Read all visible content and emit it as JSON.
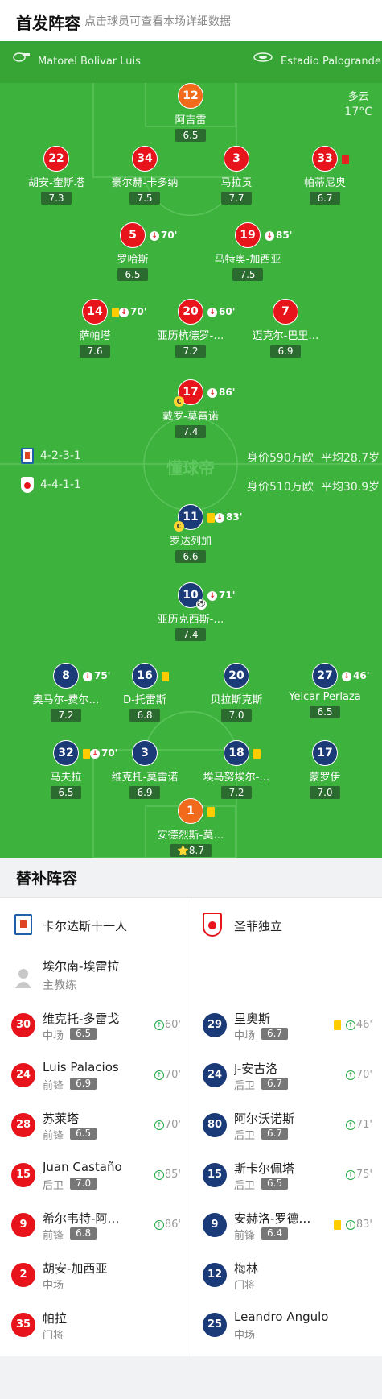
{
  "header": {
    "title": "首发阵容",
    "subtitle": "点击球员可查看本场详细数据"
  },
  "match_info": {
    "referee": "Matorel Bolivar Luis",
    "stadium": "Estadio Palogrande",
    "weather": "多云",
    "temperature": "17°C"
  },
  "colors": {
    "pitch": "#3db23d",
    "home_kit": "#e8141c",
    "away_kit": "#1a3a78",
    "goalkeeper_home": "#f26a1b",
    "goalkeeper_away": "#f26a1b",
    "yellow_card": "#ffcc00",
    "red_card": "#e52222"
  },
  "watermark": "懂球帝",
  "home_formation": {
    "formation": "4-2-3-1",
    "value": "身价590万欧",
    "avg_age": "平均28.7岁"
  },
  "away_formation": {
    "formation": "4-4-1-1",
    "value": "身价510万欧",
    "avg_age": "平均30.9岁"
  },
  "home_players": [
    {
      "number": "12",
      "name": "阿吉雷",
      "rating": "6.5",
      "gk": true,
      "events": []
    },
    {
      "number": "22",
      "name": "胡安-奎斯塔",
      "rating": "7.3",
      "events": []
    },
    {
      "number": "34",
      "name": "豪尔赫-卡多纳",
      "rating": "7.5",
      "events": []
    },
    {
      "number": "3",
      "name": "马拉贡",
      "rating": "7.7",
      "events": []
    },
    {
      "number": "33",
      "name": "帕蒂尼奥",
      "rating": "6.7",
      "events": [
        "red-card"
      ]
    },
    {
      "number": "5",
      "name": "罗哈斯",
      "rating": "6.5",
      "sub_minute": "70'"
    },
    {
      "number": "19",
      "name": "马特奥-加西亚",
      "rating": "7.5",
      "sub_minute": "85'"
    },
    {
      "number": "14",
      "name": "萨帕塔",
      "rating": "7.6",
      "sub_minute": "70'",
      "yellow": true
    },
    {
      "number": "20",
      "name": "亚历杭德罗-…",
      "rating": "7.2",
      "sub_minute": "60'"
    },
    {
      "number": "7",
      "name": "迈克尔-巴里…",
      "rating": "6.9"
    },
    {
      "number": "17",
      "name": "戴罗-莫雷诺",
      "rating": "7.4",
      "sub_minute": "86'",
      "captain": true
    }
  ],
  "away_players": [
    {
      "number": "11",
      "name": "罗达列加",
      "rating": "6.6",
      "sub_minute": "83'",
      "yellow": true,
      "captain": true
    },
    {
      "number": "10",
      "name": "亚历克西斯-…",
      "rating": "7.4",
      "sub_minute": "71'",
      "goal": true
    },
    {
      "number": "8",
      "name": "奥马尔-费尔…",
      "rating": "7.2",
      "sub_minute": "75'"
    },
    {
      "number": "16",
      "name": "D-托雷斯",
      "rating": "6.8",
      "yellow": true
    },
    {
      "number": "20",
      "name": "贝拉斯克斯",
      "rating": "7.0"
    },
    {
      "number": "27",
      "name": "Yeicar Perlaza",
      "rating": "6.5",
      "sub_minute": "46'"
    },
    {
      "number": "32",
      "name": "马夫拉",
      "rating": "6.5",
      "sub_minute": "70'",
      "yellow": true
    },
    {
      "number": "3",
      "name": "维克托-莫雷诺",
      "rating": "6.9"
    },
    {
      "number": "18",
      "name": "埃马努埃尔-…",
      "rating": "7.2",
      "yellow": true
    },
    {
      "number": "17",
      "name": "蒙罗伊",
      "rating": "7.0"
    },
    {
      "number": "1",
      "name": "安德烈斯-莫…",
      "rating": "8.7",
      "gk": true,
      "yellow": true,
      "star": "⭐"
    }
  ],
  "subs": {
    "title": "替补阵容",
    "home_team": "卡尔达斯十一人",
    "away_team": "圣菲独立",
    "coach_name": "埃尔南-埃雷拉",
    "coach_role": "主教练",
    "home": [
      {
        "number": "30",
        "name": "维克托-多雷戈",
        "pos": "中场",
        "rating": "6.5",
        "minute": "60'"
      },
      {
        "number": "24",
        "name": "Luis Palacios",
        "pos": "前锋",
        "rating": "6.9",
        "minute": "70'"
      },
      {
        "number": "28",
        "name": "苏莱塔",
        "pos": "前锋",
        "rating": "6.5",
        "minute": "70'"
      },
      {
        "number": "15",
        "name": "Juan Castaño",
        "pos": "后卫",
        "rating": "7.0",
        "minute": "85'"
      },
      {
        "number": "9",
        "name": "希尔韦特-阿…",
        "pos": "前锋",
        "rating": "6.8",
        "minute": "86'"
      },
      {
        "number": "2",
        "name": "胡安-加西亚",
        "pos": "中场"
      },
      {
        "number": "35",
        "name": "帕拉",
        "pos": "门将"
      }
    ],
    "away": [
      {
        "number": "29",
        "name": "里奥斯",
        "pos": "中场",
        "rating": "6.7",
        "minute": "46'",
        "yellow": true
      },
      {
        "number": "24",
        "name": "J-安古洛",
        "pos": "后卫",
        "rating": "6.7",
        "minute": "70'"
      },
      {
        "number": "80",
        "name": "阿尔沃诺斯",
        "pos": "后卫",
        "rating": "6.7",
        "minute": "71'"
      },
      {
        "number": "15",
        "name": "斯卡尔佩塔",
        "pos": "后卫",
        "rating": "6.5",
        "minute": "75'"
      },
      {
        "number": "9",
        "name": "安赫洛-罗德…",
        "pos": "前锋",
        "rating": "6.4",
        "minute": "83'",
        "yellow": true
      },
      {
        "number": "12",
        "name": "梅林",
        "pos": "门将"
      },
      {
        "number": "25",
        "name": "Leandro Angulo",
        "pos": "中场"
      }
    ]
  }
}
